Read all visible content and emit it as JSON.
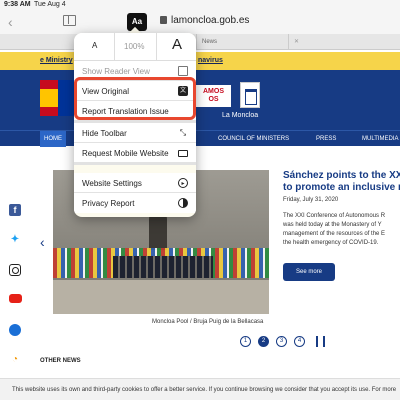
{
  "status_bar": {
    "time": "9:38 AM",
    "date": "Tue Aug 4"
  },
  "toolbar": {
    "url": "lamoncloa.gob.es",
    "back_icon": "chevron-left-icon",
    "reader_icon": "book-icon",
    "translate_icon": "translate-icon"
  },
  "tabs": [
    {
      "label": "News"
    }
  ],
  "covid_banner": {
    "left": "e Ministry",
    "right": "navirus"
  },
  "header": {
    "logo_line1": "AMOS",
    "logo_line2": "OS",
    "site_name": "La Moncloa"
  },
  "nav": {
    "home": "HOME",
    "items": [
      "COUNCIL OF MINISTERS",
      "PRESS",
      "MULTIMEDIA"
    ]
  },
  "popover": {
    "font_small": "A",
    "font_pct": "100%",
    "font_big": "A",
    "items": [
      {
        "label": "Show Reader View",
        "icon": "reader-icon"
      },
      {
        "label": "View Original",
        "icon": "translate-icon"
      },
      {
        "label": "Report Translation Issue",
        "icon": ""
      },
      {
        "label": "Hide Toolbar",
        "icon": "resize-arrows-icon"
      },
      {
        "label": "Request Mobile Website",
        "icon": "screen-icon"
      },
      {
        "label": "Website Settings",
        "icon": "settings-circle-icon"
      },
      {
        "label": "Privacy Report",
        "icon": "privacy-shield-icon"
      }
    ]
  },
  "article": {
    "title_line1": "Sánchez points to the XXI Conf",
    "title_line2": "to promote an inclusive recove",
    "date": "Friday, July 31, 2020",
    "body_lines": [
      "The XXI Conference of Autonomous R",
      "was held today at the Monastery of Y",
      "management of the resources of the E",
      "the health emergency of COVID-19."
    ],
    "see_more": "See more",
    "photo_caption": "Moncloa Pool / Bruja Puig de la Bellacasa"
  },
  "pagination": {
    "pages": [
      "1",
      "2",
      "3",
      "4"
    ],
    "active": "2"
  },
  "other_news": "OTHER NEWS",
  "cookie_text": "This website uses its own and third-party cookies to offer a better service. If you continue browsing we consider that you accept its use. For more",
  "colors": {
    "navy": "#173b84",
    "banner_yellow": "#f6d44a",
    "highlight_red": "#e8472f"
  }
}
